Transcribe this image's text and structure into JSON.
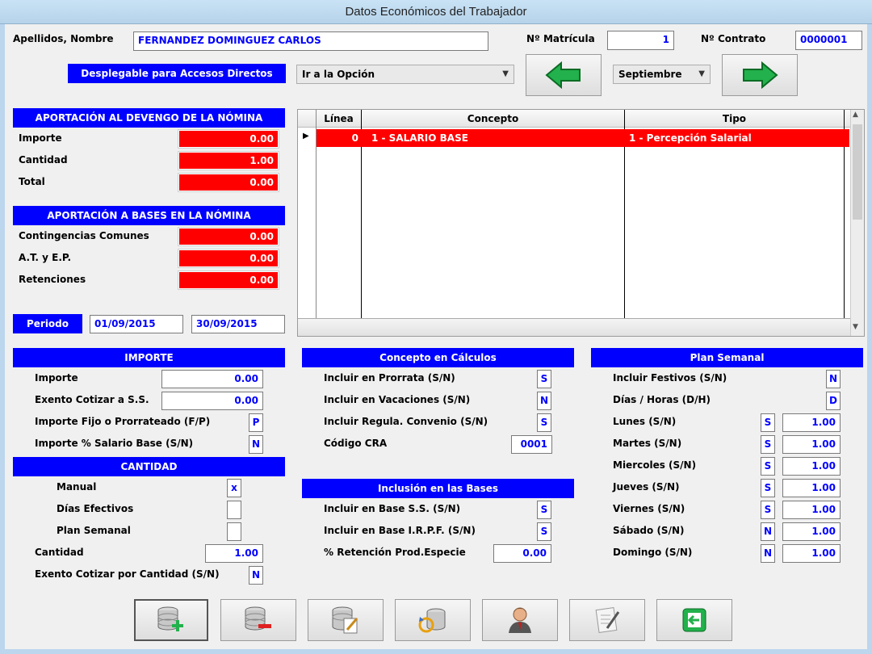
{
  "window": {
    "title": "Datos Económicos del Trabajador"
  },
  "header": {
    "name_label": "Apellidos, Nombre",
    "name_value": "FERNANDEZ DOMINGUEZ CARLOS",
    "matricula_label": "Nº Matrícula",
    "matricula_value": "1",
    "contrato_label": "Nº Contrato",
    "contrato_value": "0000001",
    "shortcuts_label": "Desplegable para Accesos Directos",
    "option_combo": "Ir a la Opción",
    "month_combo": "Septiembre"
  },
  "devengo": {
    "title": "APORTACIÓN AL DEVENGO DE LA NÓMINA",
    "importe_label": "Importe",
    "importe_value": "0.00",
    "cantidad_label": "Cantidad",
    "cantidad_value": "1.00",
    "total_label": "Total",
    "total_value": "0.00"
  },
  "bases": {
    "title": "APORTACIÓN A BASES EN LA NÓMINA",
    "cc_label": "Contingencias Comunes",
    "cc_value": "0.00",
    "at_label": "A.T. y E.P.",
    "at_value": "0.00",
    "ret_label": "Retenciones",
    "ret_value": "0.00"
  },
  "periodo": {
    "label": "Periodo",
    "from": "01/09/2015",
    "to": "30/09/2015"
  },
  "grid": {
    "columns": [
      "Línea",
      "Concepto",
      "Tipo"
    ],
    "rows": [
      {
        "linea": "0",
        "concepto": "1 - SALARIO BASE",
        "tipo": "1 - Percepción Salarial"
      }
    ]
  },
  "importe_sec": {
    "title": "IMPORTE",
    "importe_label": "Importe",
    "importe_value": "0.00",
    "exento_label": "Exento Cotizar a S.S.",
    "exento_value": "0.00",
    "fijo_label": "Importe Fijo o Prorrateado (F/P)",
    "fijo_value": "P",
    "pct_label": "Importe % Salario Base (S/N)",
    "pct_value": "N"
  },
  "cantidad_sec": {
    "title": "CANTIDAD",
    "manual_label": "Manual",
    "manual_value": "x",
    "dias_label": "Días Efectivos",
    "dias_value": "",
    "plan_label": "Plan Semanal",
    "plan_value": "",
    "cantidad_label": "Cantidad",
    "cantidad_value": "1.00",
    "exento_label": "Exento Cotizar por Cantidad (S/N)",
    "exento_value": "N"
  },
  "calculos": {
    "title": "Concepto en Cálculos",
    "prorrata_label": "Incluir en Prorrata (S/N)",
    "prorrata_value": "S",
    "vacaciones_label": "Incluir en Vacaciones (S/N)",
    "vacaciones_value": "N",
    "regula_label": "Incluir Regula. Convenio (S/N)",
    "regula_value": "S",
    "cra_label": "Código CRA",
    "cra_value": "0001"
  },
  "inclusion": {
    "title": "Inclusión en las Bases",
    "ss_label": "Incluir en Base S.S. (S/N)",
    "ss_value": "S",
    "irpf_label": "Incluir en Base I.R.P.F. (S/N)",
    "irpf_value": "S",
    "ret_label": "% Retención Prod.Especie",
    "ret_value": "0.00"
  },
  "plan": {
    "title": "Plan Semanal",
    "festivos_label": "Incluir Festivos (S/N)",
    "festivos_value": "N",
    "dh_label": "Días / Horas (D/H)",
    "dh_value": "D",
    "days": [
      {
        "label": "Lunes (S/N)",
        "flag": "S",
        "value": "1.00"
      },
      {
        "label": "Martes (S/N)",
        "flag": "S",
        "value": "1.00"
      },
      {
        "label": "Miercoles (S/N)",
        "flag": "S",
        "value": "1.00"
      },
      {
        "label": "Jueves (S/N)",
        "flag": "S",
        "value": "1.00"
      },
      {
        "label": "Viernes (S/N)",
        "flag": "S",
        "value": "1.00"
      },
      {
        "label": "Sábado (S/N)",
        "flag": "N",
        "value": "1.00"
      },
      {
        "label": "Domingo (S/N)",
        "flag": "N",
        "value": "1.00"
      }
    ]
  },
  "toolbar": {
    "icons": [
      "db-add-icon",
      "db-remove-icon",
      "db-edit-icon",
      "db-refresh-icon",
      "user-icon",
      "document-edit-icon",
      "exit-icon"
    ]
  },
  "colors": {
    "header_blue": "#0000ff",
    "red": "#ff0000",
    "arrow_green": "#22b14c"
  }
}
